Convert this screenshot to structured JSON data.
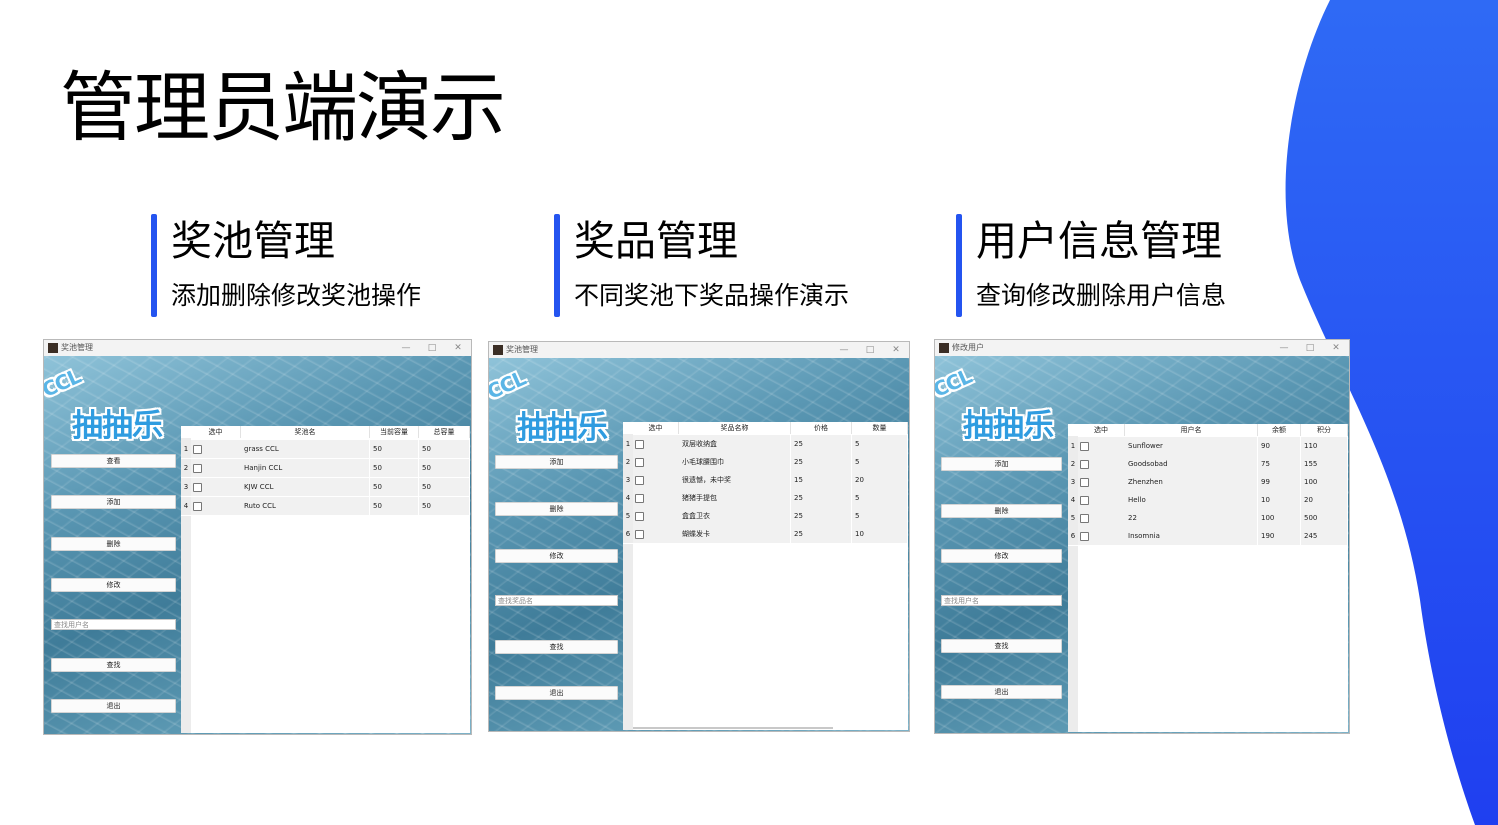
{
  "slide": {
    "title": "管理员端演示",
    "accent_color": "#2454f0",
    "sections": [
      {
        "heading": "奖池管理",
        "desc": "添加删除修改奖池操作"
      },
      {
        "heading": "奖品管理",
        "desc": "不同奖池下奖品操作演示"
      },
      {
        "heading": "用户信息管理",
        "desc": "查询修改删除用户信息"
      }
    ]
  },
  "logo": {
    "ccl": "CCL",
    "name": "抽抽乐"
  },
  "window_controls": {
    "min": "—",
    "max": "□",
    "close": "✕"
  },
  "win1": {
    "title": "奖池管理",
    "buttons": {
      "view": "查看",
      "add": "添加",
      "delete": "删除",
      "edit": "修改",
      "find": "查找",
      "exit": "退出"
    },
    "search_placeholder": "查找用户名",
    "columns": [
      "选中",
      "奖池名",
      "当前容量",
      "总容量"
    ],
    "rows": [
      {
        "no": "1",
        "name": "grass CCL",
        "cur": "50",
        "total": "50"
      },
      {
        "no": "2",
        "name": "Hanjin CCL",
        "cur": "50",
        "total": "50"
      },
      {
        "no": "3",
        "name": "KJW CCL",
        "cur": "50",
        "total": "50"
      },
      {
        "no": "4",
        "name": "Ruto CCL",
        "cur": "50",
        "total": "50"
      }
    ]
  },
  "win2": {
    "title": "奖池管理",
    "buttons": {
      "add": "添加",
      "delete": "删除",
      "edit": "修改",
      "find": "查找",
      "exit": "退出"
    },
    "search_placeholder": "查找奖品名",
    "columns": [
      "选中",
      "奖品名称",
      "价格",
      "数量"
    ],
    "rows": [
      {
        "no": "1",
        "name": "双层收纳盒",
        "price": "25",
        "qty": "5"
      },
      {
        "no": "2",
        "name": "小毛球腰围巾",
        "price": "25",
        "qty": "5"
      },
      {
        "no": "3",
        "name": "很遗憾，未中奖",
        "price": "15",
        "qty": "20"
      },
      {
        "no": "4",
        "name": "猪猪手提包",
        "price": "25",
        "qty": "5"
      },
      {
        "no": "5",
        "name": "盒盒卫衣",
        "price": "25",
        "qty": "5"
      },
      {
        "no": "6",
        "name": "蝴蝶发卡",
        "price": "25",
        "qty": "10"
      }
    ]
  },
  "win3": {
    "title": "修改用户",
    "buttons": {
      "add": "添加",
      "delete": "删除",
      "edit": "修改",
      "find": "查找",
      "exit": "退出"
    },
    "search_placeholder": "查找用户名",
    "columns": [
      "选中",
      "用户名",
      "余额",
      "积分"
    ],
    "rows": [
      {
        "no": "1",
        "name": "Sunflower",
        "balance": "90",
        "points": "110"
      },
      {
        "no": "2",
        "name": "Goodsobad",
        "balance": "75",
        "points": "155"
      },
      {
        "no": "3",
        "name": "Zhenzhen",
        "balance": "99",
        "points": "100"
      },
      {
        "no": "4",
        "name": "Hello",
        "balance": "10",
        "points": "20"
      },
      {
        "no": "5",
        "name": "22",
        "balance": "100",
        "points": "500"
      },
      {
        "no": "6",
        "name": "Insomnia",
        "balance": "190",
        "points": "245"
      }
    ]
  }
}
